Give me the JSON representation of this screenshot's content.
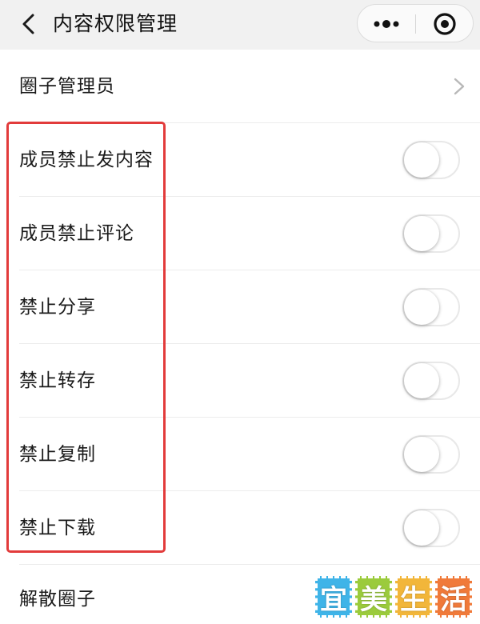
{
  "navbar": {
    "title": "内容权限管理",
    "back_icon": "chevron-left-icon",
    "more_icon": "more-dots-icon",
    "close_icon": "target-close-icon"
  },
  "rows": [
    {
      "label": "圈子管理员",
      "control": "chevron"
    },
    {
      "label": "成员禁止发内容",
      "control": "toggle",
      "on": false
    },
    {
      "label": "成员禁止评论",
      "control": "toggle",
      "on": false
    },
    {
      "label": "禁止分享",
      "control": "toggle",
      "on": false
    },
    {
      "label": "禁止转存",
      "control": "toggle",
      "on": false
    },
    {
      "label": "禁止复制",
      "control": "toggle",
      "on": false
    },
    {
      "label": "禁止下载",
      "control": "toggle",
      "on": false
    },
    {
      "label": "解散圈子",
      "control": "none"
    }
  ],
  "watermark": {
    "chars": [
      "宜",
      "美",
      "生",
      "活"
    ],
    "colors": [
      "#3fb4e8",
      "#9bcb3c",
      "#f2b63a",
      "#f07a3a"
    ]
  },
  "colors": {
    "highlight": "#e23b3b",
    "navbar_bg": "#f1f1f1"
  }
}
